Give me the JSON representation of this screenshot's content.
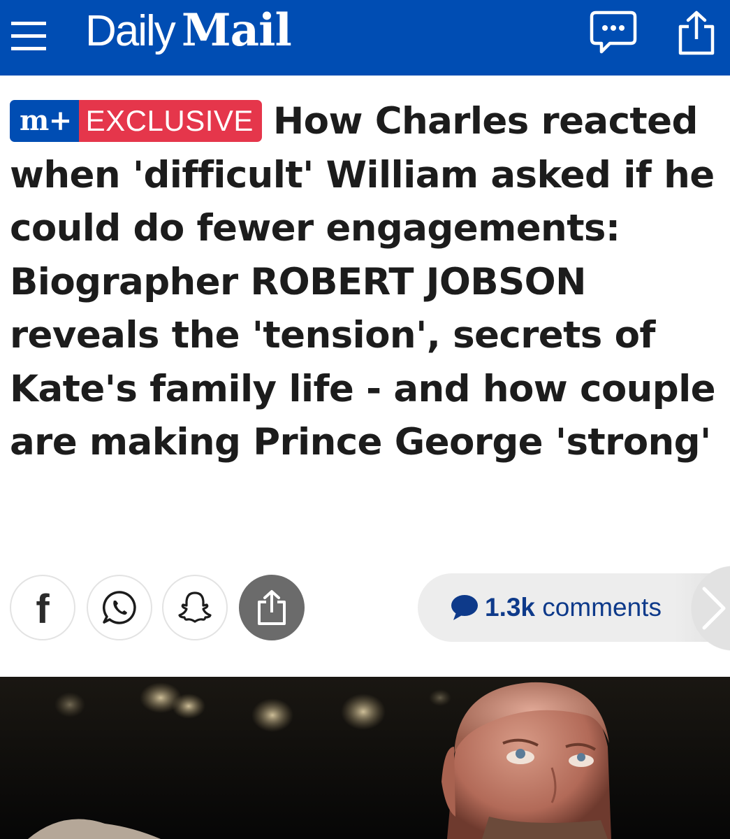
{
  "header": {
    "brand_daily": "Daily",
    "brand_mail": "Mail",
    "icons": [
      "menu-icon",
      "comments-icon",
      "share-icon"
    ],
    "colors": {
      "header_bg": "#004db3"
    }
  },
  "article": {
    "badge_mplus": "m+",
    "badge_exclusive": "EXCLUSIVE",
    "headline": "How Charles reacted when 'difficult' William asked if he could do fewer engagements: Biographer ROBERT JOBSON reveals the 'tension', secrets of Kate's family life - and how couple are making Prince George 'strong'",
    "colors": {
      "badge_mplus": "#004db3",
      "badge_exclusive": "#e5364b"
    }
  },
  "share": {
    "facebook_glyph": "f",
    "buttons": [
      "facebook-icon",
      "whatsapp-icon",
      "snapchat-icon",
      "share-icon"
    ],
    "comment_count": "1.3k",
    "comments_label": "comments"
  }
}
